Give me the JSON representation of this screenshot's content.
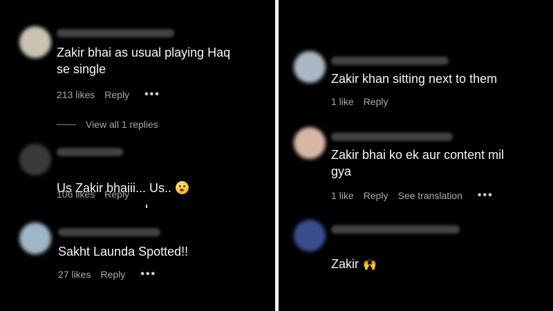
{
  "left_panel": {
    "comments": [
      {
        "text": "Zakir bhai as usual playing Haq\nse single",
        "likes": "213 likes",
        "reply": "Reply",
        "more": "•••",
        "view_replies": "View all 1 replies",
        "avatar_color": "#c9c3b0"
      },
      {
        "text": "Us Zakir bhaiii... Us..",
        "likes": "106 likes",
        "reply": "Reply",
        "emoji": "face-emoji",
        "avatar_color": "#3a3a3a"
      },
      {
        "text": "Sakht Launda Spotted!!",
        "likes": "27 likes",
        "reply": "Reply",
        "more": "•••",
        "avatar_color": "#9fb6c7"
      }
    ]
  },
  "right_panel": {
    "comments": [
      {
        "text": "Zakir khan sitting next to them",
        "likes": "1 like",
        "reply": "Reply",
        "avatar_color": "#a9b8c4"
      },
      {
        "text": "Zakir bhai ko ek aur content mil\ngya",
        "likes": "1 like",
        "reply": "Reply",
        "translate": "See translation",
        "more": "•••",
        "avatar_color": "#d8b6a6"
      },
      {
        "text": "Zakir",
        "emoji": "raised-hands-emoji",
        "emoji_char": "🙌",
        "avatar_color": "#3a4d8f"
      }
    ]
  }
}
